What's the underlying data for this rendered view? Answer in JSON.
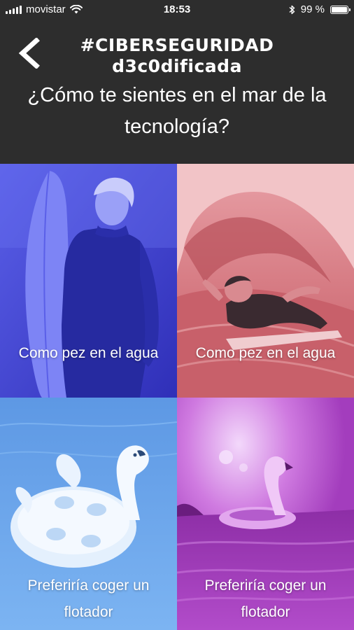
{
  "status_bar": {
    "carrier": "movistar",
    "time": "18:53",
    "battery_pct": "99 %",
    "battery_level": 0.99,
    "icons": [
      "signal-icon",
      "wifi-icon",
      "bluetooth-icon",
      "battery-icon"
    ]
  },
  "header": {
    "back_icon": "chevron-left-icon",
    "brand_line1": "#CIBERSEGURIDAD",
    "brand_line2": "d3c0dificada",
    "question": "¿Cómo te sientes en el mar de la tecnología?",
    "background": "#2d2d2d"
  },
  "options": [
    {
      "label": "Como pez en el agua",
      "color": "#4346d6"
    },
    {
      "label": "Como pez en el agua",
      "color": "#d4727a"
    },
    {
      "label": "Preferiría coger un flotador",
      "color": "#6ea8f0"
    },
    {
      "label": "Preferiría coger un flotador",
      "color": "#b346c9"
    }
  ]
}
